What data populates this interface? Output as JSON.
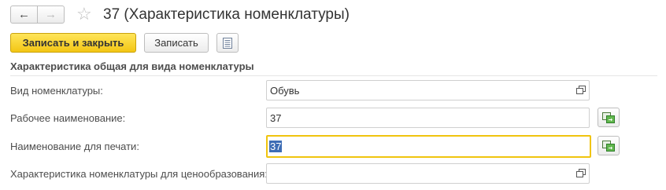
{
  "window": {
    "title": "37 (Характеристика номенклатуры)",
    "nav": {
      "back_icon": "arrow-left-icon",
      "forward_icon": "arrow-right-icon"
    },
    "favorite_icon": "star-icon"
  },
  "toolbar": {
    "save_close_label": "Записать и закрыть",
    "save_label": "Записать",
    "more_icon": "list-icon"
  },
  "section": {
    "title": "Характеристика общая для вида номенклатуры"
  },
  "fields": [
    {
      "label": "Вид номенклатуры:",
      "value": "Обувь",
      "button_icon": "open-icon"
    },
    {
      "label": "Рабочее наименование:",
      "value": "37",
      "side_button_icon": "translate-icon"
    },
    {
      "label": "Наименование для печати:",
      "value": "37",
      "selected": true,
      "side_button_icon": "translate-icon"
    },
    {
      "label": "Характеристика номенклатуры для ценообразования:",
      "value": "",
      "button_icon": "open-icon"
    }
  ],
  "colors": {
    "primary_button": "#f3c614",
    "focus_border": "#f0c40e",
    "selection": "#3e6db5"
  }
}
